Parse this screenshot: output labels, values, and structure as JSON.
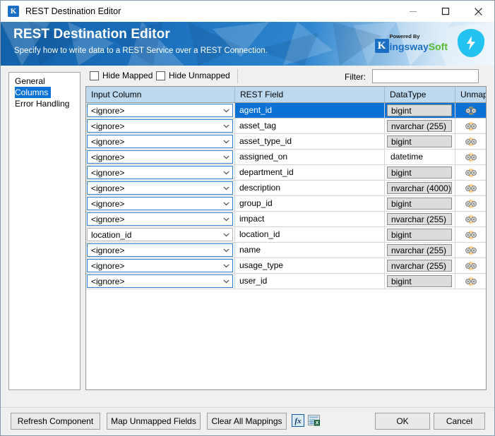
{
  "window": {
    "title": "REST Destination Editor",
    "app_icon": "kingswaysoft-k-icon",
    "minimize_label": "Minimize",
    "maximize_label": "Maximize",
    "close_label": "Close"
  },
  "banner": {
    "title": "REST Destination Editor",
    "subtitle": "Specify how to write data to a REST Service over a REST Connection.",
    "logo_k": "K",
    "logo_powered_by": "Powered By",
    "logo_kingsway": "ingsway",
    "logo_soft": "Soft",
    "bolt_icon": "lightning-bolt-icon",
    "accent_blue": "#1a6fc4",
    "accent_green": "#58b832",
    "bolt_color": "#22c3f0"
  },
  "sidebar": {
    "items": [
      {
        "label": "General",
        "selected": false
      },
      {
        "label": "Columns",
        "selected": true
      },
      {
        "label": "Error Handling",
        "selected": false
      }
    ],
    "selection_color": "#0a72d4"
  },
  "options": {
    "hide_mapped_label": "Hide Mapped",
    "hide_mapped_checked": false,
    "hide_unmapped_label": "Hide Unmapped",
    "hide_unmapped_checked": false,
    "filter_label": "Filter:",
    "filter_value": "",
    "filter_placeholder": ""
  },
  "grid": {
    "columns": [
      "Input Column",
      "REST Field",
      "DataType",
      "Unmap"
    ],
    "header_bg": "#bcd9ef",
    "unmap_icon": "unmap-link-icon",
    "rows": [
      {
        "input": "<ignore>",
        "field": "agent_id",
        "datatype": "bigint",
        "boxed": true,
        "selected": true,
        "mapped": false
      },
      {
        "input": "<ignore>",
        "field": "asset_tag",
        "datatype": "nvarchar (255)",
        "boxed": true,
        "selected": false,
        "mapped": false
      },
      {
        "input": "<ignore>",
        "field": "asset_type_id",
        "datatype": "bigint",
        "boxed": true,
        "selected": false,
        "mapped": false
      },
      {
        "input": "<ignore>",
        "field": "assigned_on",
        "datatype": "datetime",
        "boxed": false,
        "selected": false,
        "mapped": false
      },
      {
        "input": "<ignore>",
        "field": "department_id",
        "datatype": "bigint",
        "boxed": true,
        "selected": false,
        "mapped": false
      },
      {
        "input": "<ignore>",
        "field": "description",
        "datatype": "nvarchar (4000)",
        "boxed": true,
        "selected": false,
        "mapped": false
      },
      {
        "input": "<ignore>",
        "field": "group_id",
        "datatype": "bigint",
        "boxed": true,
        "selected": false,
        "mapped": false
      },
      {
        "input": "<ignore>",
        "field": "impact",
        "datatype": "nvarchar (255)",
        "boxed": true,
        "selected": false,
        "mapped": false
      },
      {
        "input": "location_id",
        "field": "location_id",
        "datatype": "bigint",
        "boxed": true,
        "selected": false,
        "mapped": true
      },
      {
        "input": "<ignore>",
        "field": "name",
        "datatype": "nvarchar (255)",
        "boxed": true,
        "selected": false,
        "mapped": false
      },
      {
        "input": "<ignore>",
        "field": "usage_type",
        "datatype": "nvarchar (255)",
        "boxed": true,
        "selected": false,
        "mapped": false
      },
      {
        "input": "<ignore>",
        "field": "user_id",
        "datatype": "bigint",
        "boxed": true,
        "selected": false,
        "mapped": false
      }
    ]
  },
  "footer": {
    "refresh_component": "Refresh Component",
    "map_unmapped_fields": "Map Unmapped Fields",
    "clear_all_mappings": "Clear All Mappings",
    "fx_icon": "fx-expression-icon",
    "export_icon": "export-to-excel-icon",
    "ok": "OK",
    "cancel": "Cancel"
  }
}
